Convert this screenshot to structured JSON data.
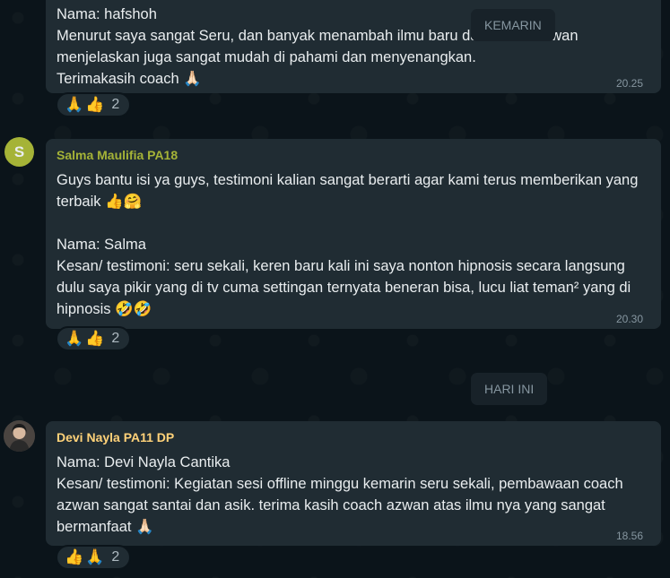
{
  "messages": [
    {
      "lines": "Nama: hafshoh\nMenurut saya sangat Seru, dan banyak menambah ilmu baru dari coach Azwan menjelaskan juga sangat mudah di pahami dan menyenangkan.\nTerimakasih coach 🙏🏻",
      "time": "20.25",
      "reactions": [
        "🙏",
        "👍"
      ],
      "reaction_count": "2"
    },
    {
      "sender": "Salma Maulifia PA18",
      "sender_color": "#a5b337",
      "avatar_letter": "S",
      "avatar_color": "#a5b337",
      "lines": "Guys bantu isi ya guys, testimoni kalian sangat berarti agar kami terus memberikan yang terbaik 👍🤗\n\nNama: Salma\nKesan/ testimoni: seru sekali, keren baru kali ini saya nonton hipnosis secara langsung dulu saya pikir yang di tv cuma settingan ternyata beneran bisa, lucu liat teman² yang di hipnosis 🤣🤣",
      "time": "20.30",
      "reactions": [
        "🙏",
        "👍"
      ],
      "reaction_count": "2"
    },
    {
      "sender": "Devi Nayla PA11 DP",
      "sender_color": "#ffd279",
      "lines": "Nama: Devi Nayla Cantika\nKesan/ testimoni: Kegiatan sesi offline minggu kemarin seru sekali, pembawaan coach azwan sangat santai dan asik. terima kasih coach azwan atas ilmu nya yang sangat bermanfaat 🙏🏻",
      "time": "18.56",
      "reactions": [
        "👍",
        "🙏"
      ],
      "reaction_count": "2"
    }
  ],
  "date_chips": {
    "yesterday": "KEMARIN",
    "today": "HARI INI"
  }
}
